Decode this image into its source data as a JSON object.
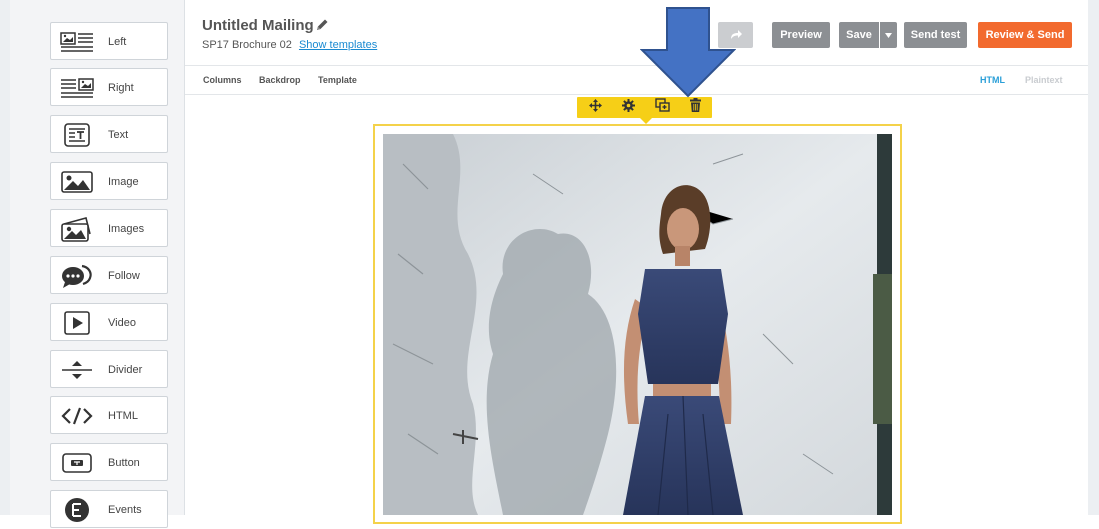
{
  "sidebar": {
    "blocks": [
      {
        "label": "Left",
        "icon": "layout-left-icon"
      },
      {
        "label": "Right",
        "icon": "layout-right-icon"
      },
      {
        "label": "Text",
        "icon": "text-block-icon"
      },
      {
        "label": "Image",
        "icon": "image-icon"
      },
      {
        "label": "Images",
        "icon": "images-icon"
      },
      {
        "label": "Follow",
        "icon": "follow-chat-icon"
      },
      {
        "label": "Video",
        "icon": "video-play-icon"
      },
      {
        "label": "Divider",
        "icon": "divider-icon"
      },
      {
        "label": "HTML",
        "icon": "code-icon"
      },
      {
        "label": "Button",
        "icon": "button-icon"
      },
      {
        "label": "Events",
        "icon": "events-icon"
      }
    ]
  },
  "header": {
    "title": "Untitled Mailing",
    "subtitle": "SP17 Brochure 02",
    "show_templates": "Show templates",
    "buttons": {
      "preview": "Preview",
      "save": "Save",
      "send_test": "Send test",
      "review_send": "Review & Send"
    }
  },
  "toolbar": {
    "columns": "Columns",
    "backdrop": "Backdrop",
    "template": "Template",
    "html": "HTML",
    "plaintext": "Plaintext"
  },
  "colors": {
    "accent_orange": "#f26a2e",
    "button_gray": "#8c8f93",
    "selection_yellow": "#f6cf17",
    "link_blue": "#1a8ad1",
    "annotation_arrow": "#4472c4"
  }
}
